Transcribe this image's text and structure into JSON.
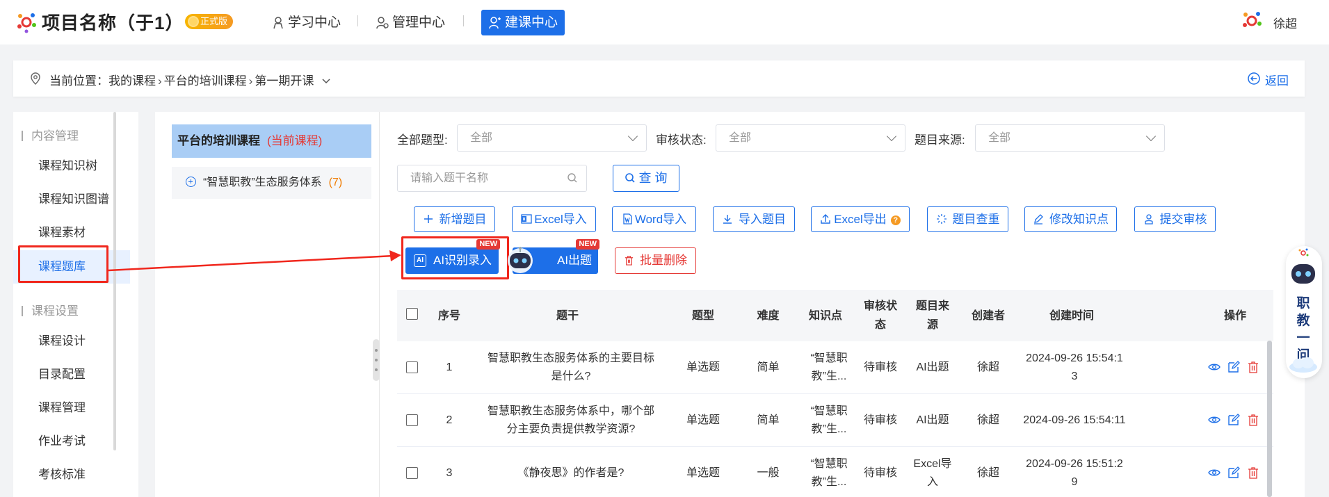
{
  "header": {
    "project_title": "项目名称（于1）",
    "edition_badge": "正式版",
    "nav": [
      {
        "label": "学习中心",
        "icon": "user-badge-icon",
        "active": false
      },
      {
        "label": "管理中心",
        "icon": "manage-icon",
        "active": false
      },
      {
        "label": "建课中心",
        "icon": "build-course-icon",
        "active": true
      }
    ],
    "user_name": "徐超"
  },
  "breadcrumb": {
    "prefix": "当前位置：",
    "items": [
      "我的课程",
      "平台的培训课程",
      "第一期开课"
    ],
    "return_label": "返回"
  },
  "sidebar": {
    "groups": [
      {
        "title": "内容管理",
        "items": [
          "课程知识树",
          "课程知识图谱",
          "课程素材",
          "课程题库"
        ]
      },
      {
        "title": "课程设置",
        "items": [
          "课程设计",
          "目录配置",
          "课程管理",
          "作业考试",
          "考核标准"
        ]
      }
    ],
    "active_item": "课程题库"
  },
  "tree": {
    "course_title": "平台的培训课程",
    "current_tag": "(当前课程)",
    "node_label": "“智慧职教”生态服务体系",
    "node_count": "(7)"
  },
  "filters": {
    "type_label": "全部题型:",
    "type_value": "全部",
    "review_label": "审核状态:",
    "review_value": "全部",
    "source_label": "题目来源:",
    "source_value": "全部",
    "search_placeholder": "请输入题干名称",
    "query_label": "查 询"
  },
  "toolbar": {
    "add": "新增题目",
    "excel_import": "Excel导入",
    "word_import": "Word导入",
    "import_questions": "导入题目",
    "excel_export": "Excel导出",
    "dedupe": "题目查重",
    "edit_knowledge": "修改知识点",
    "submit_review": "提交审核",
    "ai_recognize": "AI识别录入",
    "ai_generate": "AI出题",
    "new_tag": "NEW",
    "batch_delete": "批量删除"
  },
  "table": {
    "columns": [
      "序号",
      "题干",
      "题型",
      "难度",
      "知识点",
      "审核状态",
      "题目来源",
      "创建者",
      "创建时间",
      "操作"
    ],
    "rows": [
      {
        "index": "1",
        "stem": "智慧职教生态服务体系的主要目标是什么?",
        "type": "单选题",
        "difficulty": "简单",
        "knowledge": "“智慧职教”生...",
        "review": "待审核",
        "source": "AI出题",
        "creator": "徐超",
        "created": "2024-09-26 15:54:13"
      },
      {
        "index": "2",
        "stem": "智慧职教生态服务体系中，哪个部分主要负责提供教学资源?",
        "type": "单选题",
        "difficulty": "简单",
        "knowledge": "“智慧职教”生...",
        "review": "待审核",
        "source": "AI出题",
        "creator": "徐超",
        "created": "2024-09-26 15:54:11"
      },
      {
        "index": "3",
        "stem": "《静夜思》的作者是?",
        "type": "单选题",
        "difficulty": "一般",
        "knowledge": "“智慧职教”生...",
        "review": "待审核",
        "source": "Excel导入",
        "creator": "徐超",
        "created": "2024-09-26 15:51:29"
      }
    ]
  },
  "assistant": {
    "label": "职教一问"
  },
  "colors": {
    "primary": "#1d6fe8",
    "danger": "#e53935",
    "highlight": "#f0271d",
    "badge": "#f7b500"
  }
}
